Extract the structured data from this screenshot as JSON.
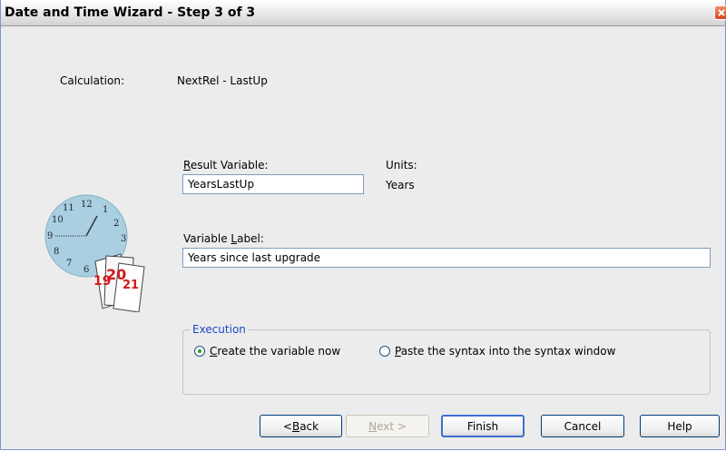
{
  "window": {
    "title": "Date and Time Wizard - Step 3 of 3"
  },
  "calculation": {
    "label": "Calculation:",
    "value": "NextRel - LastUp"
  },
  "result_variable": {
    "label_prefix": "R",
    "label_rest": "esult Variable:",
    "value": "YearsLastUp"
  },
  "units": {
    "label": "Units:",
    "value": "Years"
  },
  "variable_label": {
    "label_prefix": "Variable ",
    "label_accel": "L",
    "label_rest": "abel:",
    "value": "Years since last upgrade"
  },
  "execution": {
    "legend": "Execution",
    "options": [
      {
        "accel": "C",
        "rest": "reate the variable now",
        "selected": true
      },
      {
        "accel": "P",
        "rest": "aste the syntax into the syntax window",
        "selected": false
      }
    ]
  },
  "illustration": {
    "clock_numbers": [
      "12",
      "1",
      "2",
      "3",
      "6",
      "7",
      "8",
      "9",
      "10",
      "11"
    ],
    "calendar_numbers": [
      "19",
      "20",
      "21"
    ]
  },
  "buttons": {
    "back": {
      "prefix": "< ",
      "accel": "B",
      "rest": "ack"
    },
    "next": {
      "accel": "N",
      "rest": "ext >"
    },
    "finish": "Finish",
    "cancel": "Cancel",
    "help": "Help"
  },
  "colors": {
    "accent": "#1a46c9",
    "clock_face": "#a9cfe0",
    "calendar_red": "#d41818"
  }
}
